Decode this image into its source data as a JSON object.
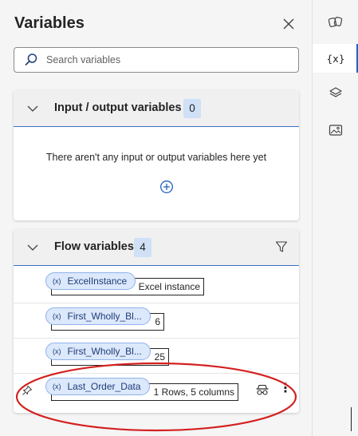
{
  "panel": {
    "title": "Variables",
    "search_placeholder": "Search variables"
  },
  "io_section": {
    "title": "Input / output variables",
    "count": "0",
    "empty_message": "There aren't any input or output variables here yet"
  },
  "flow_section": {
    "title": "Flow variables",
    "count": "4",
    "variables": [
      {
        "tag": "(x)",
        "name": "ExcelInstance",
        "value": "Excel instance"
      },
      {
        "tag": "(x)",
        "name": "First_Wholly_Bl...",
        "value": "6"
      },
      {
        "tag": "(x)",
        "name": "First_Wholly_Bl...",
        "value": "25"
      },
      {
        "tag": "(x)",
        "name": "Last_Order_Data",
        "value": "1 Rows, 5 columns"
      }
    ]
  },
  "rail": {
    "variables_label": "{x}"
  },
  "colors": {
    "accent": "#2563c9",
    "annotation": "#d42020",
    "pill_bg": "#dce8fb",
    "count_bg": "#cfe0f7"
  }
}
